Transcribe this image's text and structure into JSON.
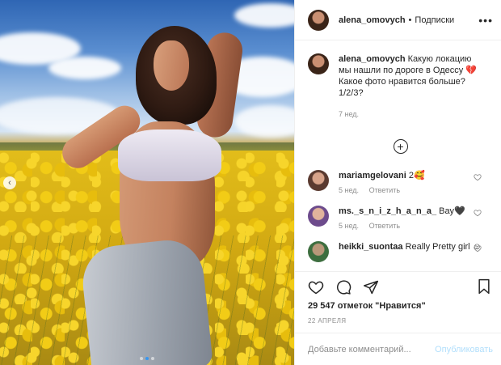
{
  "post": {
    "author": "alena_omovych",
    "separator": "•",
    "follow_label": "Подписки",
    "more_label": "•••",
    "caption_text": "Какую локацию мы нашли по дороге в Одессу 💔 Какое фото нравится больше? 1/2/3?",
    "caption_time": "7 нед.",
    "load_more_label": "+",
    "comments": [
      {
        "user": "mariamgelovani",
        "text": "2🥰",
        "time": "5 нед.",
        "reply": "Ответить"
      },
      {
        "user": "ms._s_n_i_z_h_a_n_a_",
        "text": "Вау🖤",
        "time": "5 нед.",
        "reply": "Ответить"
      },
      {
        "user": "heikki_suontaa",
        "text": "Really Pretty girl ☺",
        "time": "",
        "reply": ""
      }
    ],
    "likes": "29 547 отметок \"Нравится\"",
    "date": "22 АПРЕЛЯ",
    "comment_placeholder": "Добавьте комментарий...",
    "publish_label": "Опубликовать",
    "nav_prev": "‹"
  },
  "carousel": {
    "slides": 3,
    "active": 1
  },
  "colors": {
    "link": "#3897f0",
    "muted": "#8e8e8e",
    "text": "#262626",
    "publish_disabled": "#b2dffc"
  },
  "icons": [
    "heart-icon",
    "comment-icon",
    "share-icon",
    "bookmark-icon",
    "more-icon",
    "plus-circle-icon",
    "chevron-left-icon"
  ]
}
